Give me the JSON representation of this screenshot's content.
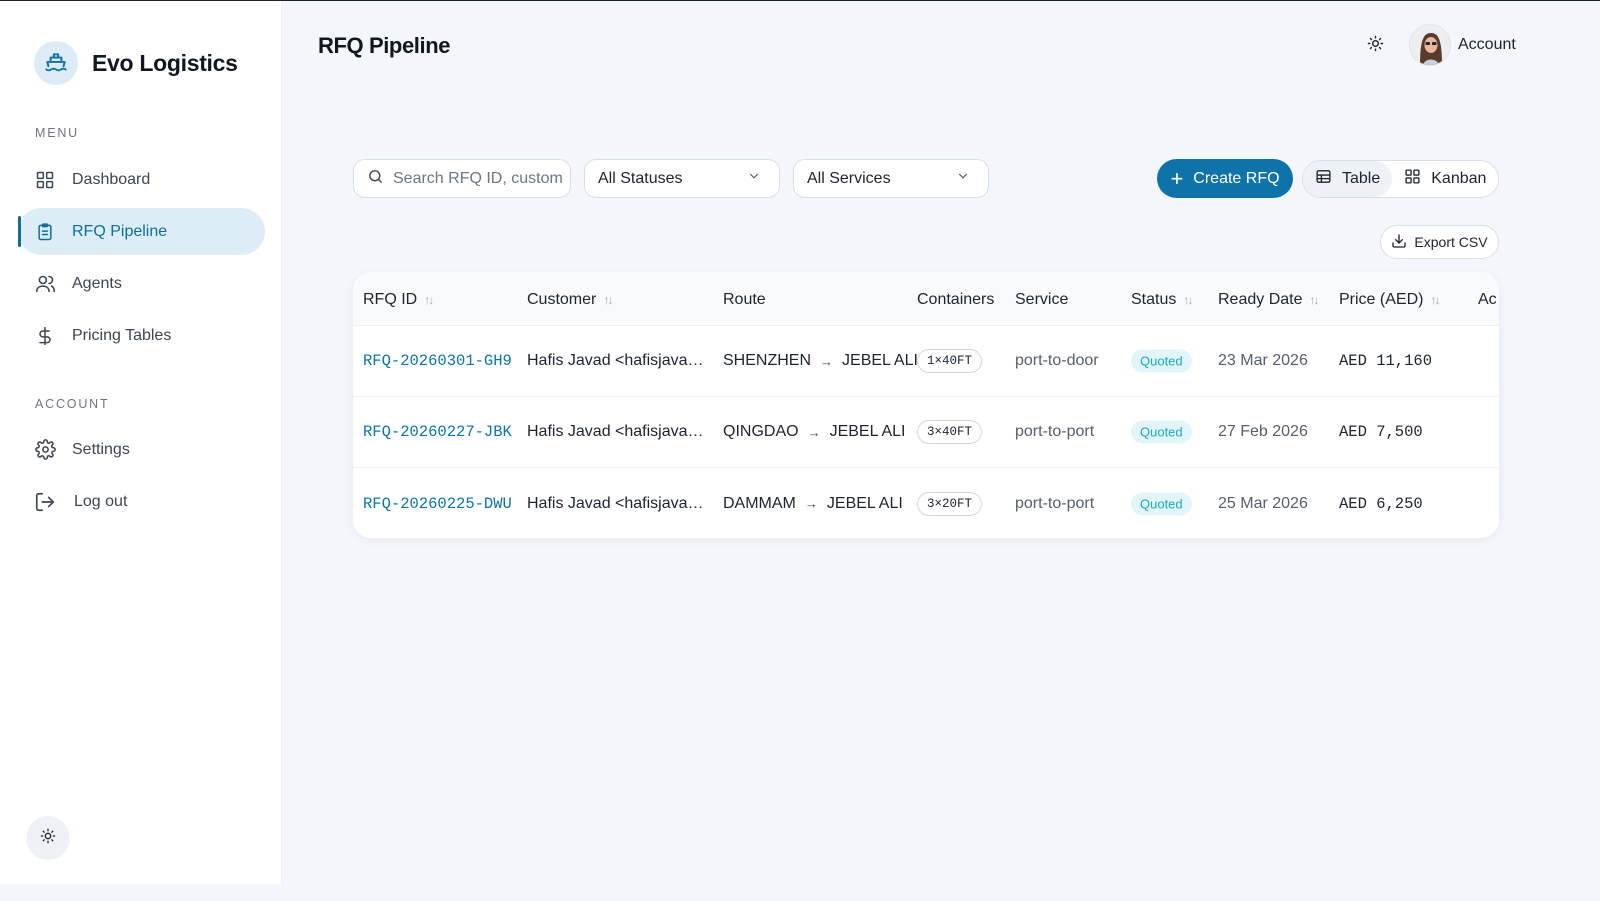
{
  "brand": {
    "name": "Evo Logistics"
  },
  "sidebar": {
    "menu_label": "MENU",
    "account_label": "ACCOUNT",
    "menu_items": [
      {
        "label": "Dashboard",
        "icon": "grid-icon"
      },
      {
        "label": "RFQ Pipeline",
        "icon": "clipboard-icon",
        "active": true
      },
      {
        "label": "Agents",
        "icon": "users-icon"
      },
      {
        "label": "Pricing Tables",
        "icon": "dollar-icon"
      }
    ],
    "account_items": [
      {
        "label": "Settings",
        "icon": "gear-icon"
      },
      {
        "label": "Log out",
        "icon": "logout-icon"
      }
    ]
  },
  "header": {
    "title": "RFQ Pipeline",
    "account_label": "Account"
  },
  "toolbar": {
    "search_placeholder": "Search RFQ ID, customer...",
    "status_filter": "All Statuses",
    "service_filter": "All Services",
    "create_label": "Create RFQ",
    "view_table": "Table",
    "view_kanban": "Kanban",
    "export_label": "Export CSV"
  },
  "table": {
    "columns": [
      "RFQ ID",
      "Customer",
      "Route",
      "Containers",
      "Service",
      "Status",
      "Ready Date",
      "Price (AED)",
      "Ac"
    ],
    "rows": [
      {
        "id": "RFQ-20260301-GH9",
        "customer": "Hafis Javad <hafisjavad…",
        "origin": "SHENZHEN",
        "destination": "JEBEL ALI",
        "containers": "1×40FT",
        "service": "port-to-door",
        "status": "Quoted",
        "ready": "23 Mar 2026",
        "price": "AED 11,160"
      },
      {
        "id": "RFQ-20260227-JBK",
        "customer": "Hafis Javad <hafisjavad…",
        "origin": "QINGDAO",
        "destination": "JEBEL ALI",
        "containers": "3×40FT",
        "service": "port-to-port",
        "status": "Quoted",
        "ready": "27 Feb 2026",
        "price": "AED 7,500"
      },
      {
        "id": "RFQ-20260225-DWU",
        "customer": "Hafis Javad <hafisjavad…",
        "origin": "DAMMAM",
        "destination": "JEBEL ALI",
        "containers": "3×20FT",
        "service": "port-to-port",
        "status": "Quoted",
        "ready": "25 Mar 2026",
        "price": "AED 6,250"
      }
    ]
  },
  "colors": {
    "accent": "#0d73a8",
    "active_bg": "#dcedf6",
    "status_quoted": "#1aa9c2"
  }
}
